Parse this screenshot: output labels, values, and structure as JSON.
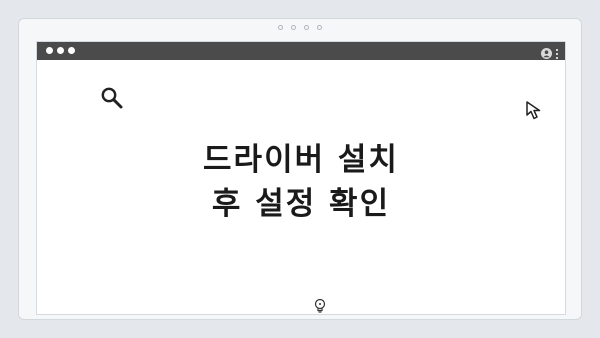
{
  "headline": {
    "line1": "드라이버 설치",
    "line2": "후 설정 확인"
  },
  "icons": {
    "search": "search-icon",
    "cursor": "cursor-arrow-icon",
    "lightbulb": "lightbulb-icon",
    "profile": "user-icon",
    "menu": "kebab-menu-icon"
  },
  "colors": {
    "titlebar": "#4b4b4b",
    "background": "#e4e7eb",
    "window": "#ffffff",
    "text": "#1a1a1a"
  }
}
